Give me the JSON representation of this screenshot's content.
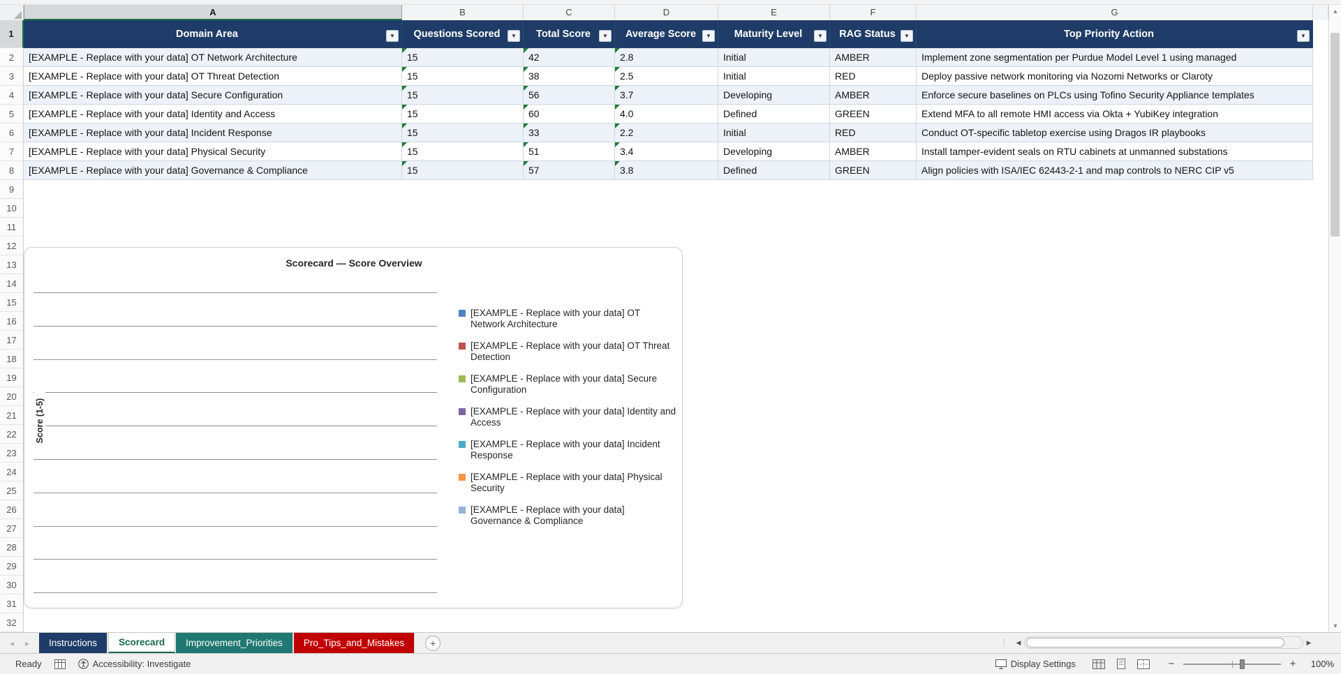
{
  "columns": {
    "letters": [
      "A",
      "B",
      "C",
      "D",
      "E",
      "F",
      "G"
    ]
  },
  "rows": {
    "numbers": [
      1,
      2,
      3,
      4,
      5,
      6,
      7,
      8,
      9,
      10,
      11,
      12,
      13,
      14,
      15,
      16,
      17,
      18,
      19,
      20,
      21,
      22,
      23,
      24,
      25,
      26,
      27,
      28,
      29,
      30,
      31,
      32
    ]
  },
  "table": {
    "headers": [
      "Domain Area",
      "Questions Scored",
      "Total Score",
      "Average Score",
      "Maturity Level",
      "RAG Status",
      "Top Priority Action"
    ],
    "data": [
      {
        "domain": "[EXAMPLE - Replace with your data] OT Network Architecture",
        "questions": "15",
        "total": "42",
        "average": "2.8",
        "maturity": "Initial",
        "rag": "AMBER",
        "action": "Implement zone segmentation per Purdue Model Level 1 using managed"
      },
      {
        "domain": "[EXAMPLE - Replace with your data] OT Threat Detection",
        "questions": "15",
        "total": "38",
        "average": "2.5",
        "maturity": "Initial",
        "rag": "RED",
        "action": "Deploy passive network monitoring via Nozomi Networks or Claroty"
      },
      {
        "domain": "[EXAMPLE - Replace with your data] Secure Configuration",
        "questions": "15",
        "total": "56",
        "average": "3.7",
        "maturity": "Developing",
        "rag": "AMBER",
        "action": "Enforce secure baselines on PLCs using Tofino Security Appliance templates"
      },
      {
        "domain": "[EXAMPLE - Replace with your data] Identity and Access",
        "questions": "15",
        "total": "60",
        "average": "4.0",
        "maturity": "Defined",
        "rag": "GREEN",
        "action": "Extend MFA to all remote HMI access via Okta + YubiKey integration"
      },
      {
        "domain": "[EXAMPLE - Replace with your data] Incident Response",
        "questions": "15",
        "total": "33",
        "average": "2.2",
        "maturity": "Initial",
        "rag": "RED",
        "action": "Conduct OT-specific tabletop exercise using Dragos IR playbooks"
      },
      {
        "domain": "[EXAMPLE - Replace with your data] Physical Security",
        "questions": "15",
        "total": "51",
        "average": "3.4",
        "maturity": "Developing",
        "rag": "AMBER",
        "action": "Install tamper-evident seals on RTU cabinets at unmanned substations"
      },
      {
        "domain": "[EXAMPLE - Replace with your data] Governance & Compliance",
        "questions": "15",
        "total": "57",
        "average": "3.8",
        "maturity": "Defined",
        "rag": "GREEN",
        "action": "Align policies with ISA/IEC 62443-2-1 and map controls to NERC CIP v5"
      }
    ]
  },
  "chart": {
    "title": "Scorecard — Score Overview",
    "y_axis_label": "Score (1-5)",
    "legend": [
      {
        "label": "[EXAMPLE - Replace with your data] OT Network Architecture",
        "color": "#4F81BD"
      },
      {
        "label": "[EXAMPLE - Replace with your data] OT Threat Detection",
        "color": "#C0504D"
      },
      {
        "label": "[EXAMPLE - Replace with your data] Secure Configuration",
        "color": "#9BBB59"
      },
      {
        "label": "[EXAMPLE - Replace with your data] Identity and Access",
        "color": "#8064A2"
      },
      {
        "label": "[EXAMPLE - Replace with your data] Incident Response",
        "color": "#4BACC6"
      },
      {
        "label": "[EXAMPLE - Replace with your data] Physical Security",
        "color": "#F79646"
      },
      {
        "label": "[EXAMPLE - Replace with your data] Governance & Compliance",
        "color": "#95B3D7"
      }
    ]
  },
  "sheet_tabs": [
    {
      "label": "Instructions",
      "bg": "#1f3c68",
      "fg": "#ffffff",
      "active": false
    },
    {
      "label": "Scorecard",
      "bg": "#ffffff",
      "fg": "#17694a",
      "active": true
    },
    {
      "label": "Improvement_Priorities",
      "bg": "#1f7872",
      "fg": "#ffffff",
      "active": false
    },
    {
      "label": "Pro_Tips_and_Mistakes",
      "bg": "#c00000",
      "fg": "#ffffff",
      "active": false
    }
  ],
  "status_bar": {
    "ready": "Ready",
    "accessibility": "Accessibility: Investigate",
    "display_settings": "Display Settings",
    "zoom_level": "100%"
  },
  "colors": {
    "header_bg": "#1f3c68",
    "band_row": "#edf2f9",
    "table_border": "#ccd6e6",
    "selection_green": "#1e7145",
    "error_triangle": "#1e7b34"
  }
}
